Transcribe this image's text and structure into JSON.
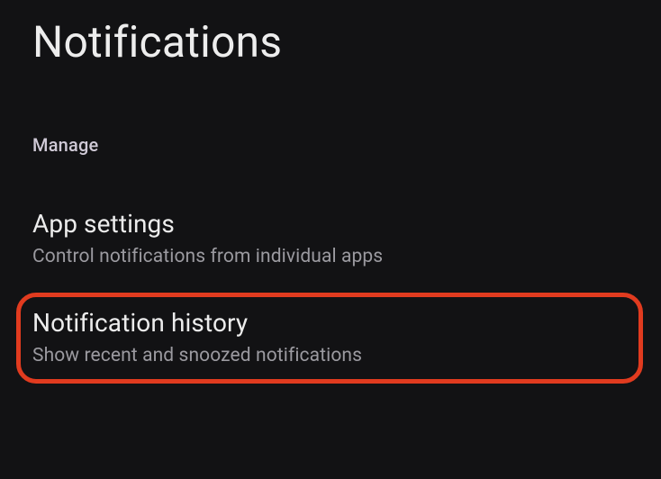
{
  "page": {
    "title": "Notifications"
  },
  "section": {
    "header": "Manage"
  },
  "items": [
    {
      "title": "App settings",
      "subtitle": "Control notifications from individual apps"
    },
    {
      "title": "Notification history",
      "subtitle": "Show recent and snoozed notifications"
    }
  ],
  "highlight": {
    "color": "#e13b1f"
  }
}
